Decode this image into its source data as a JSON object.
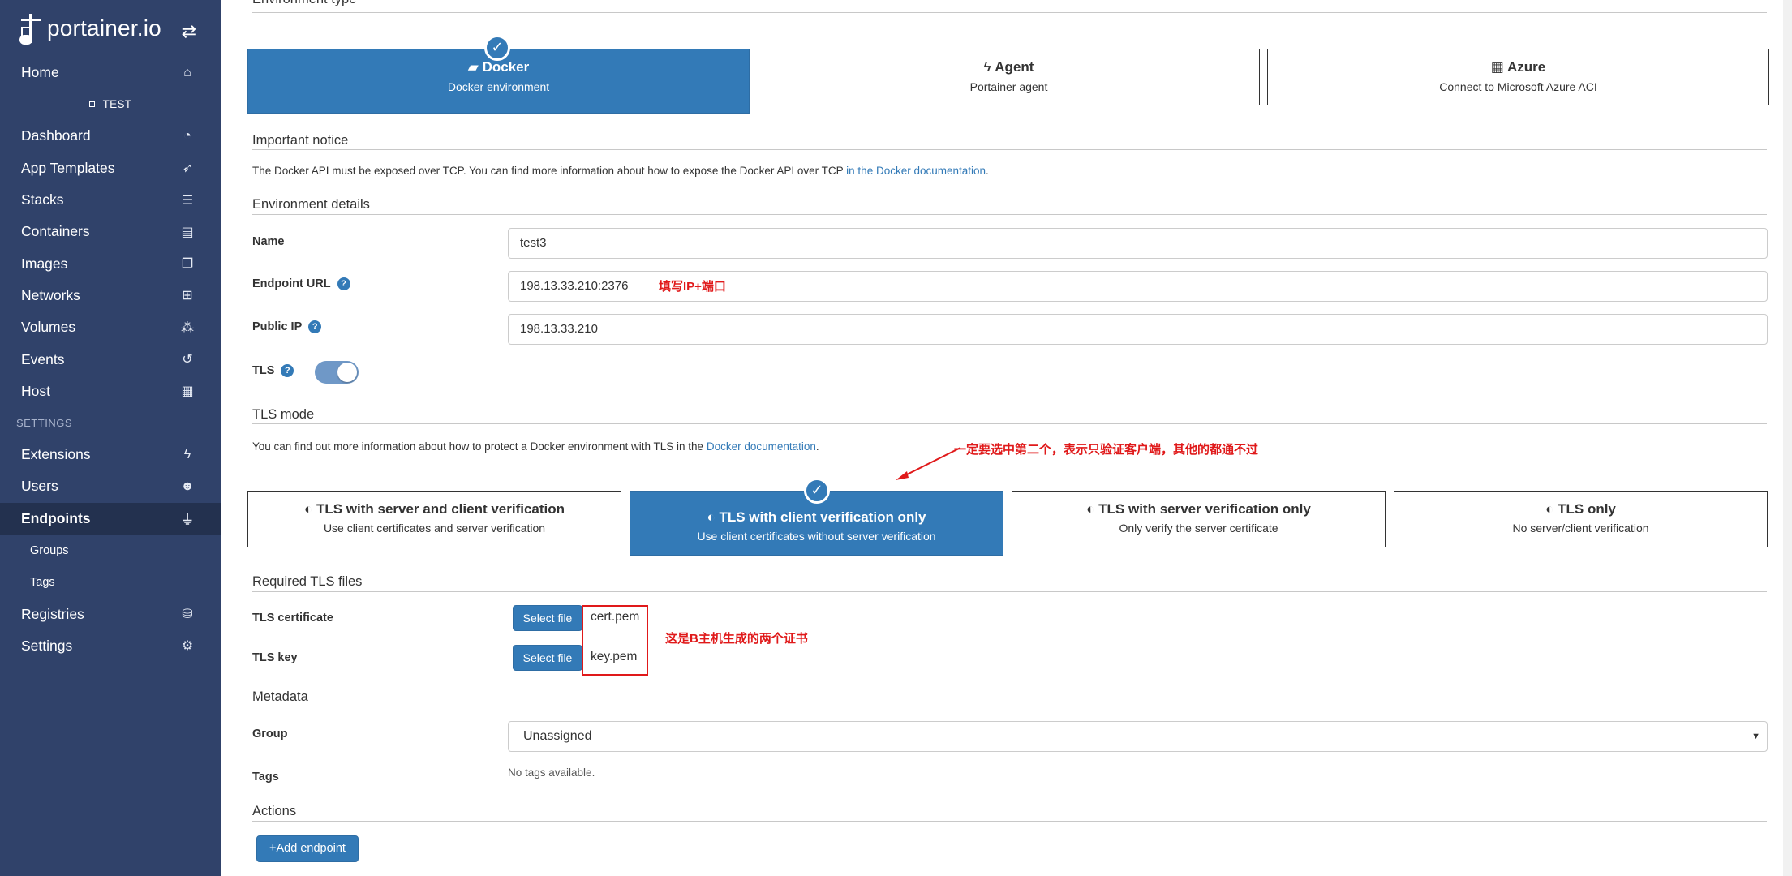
{
  "sidebar": {
    "logo_text": "portainer.io",
    "toggle_icon": "swap-arrows-icon",
    "home_label": "Home",
    "environment_name": "TEST",
    "items": [
      {
        "label": "Dashboard",
        "icon": "tachometer-icon"
      },
      {
        "label": "App Templates",
        "icon": "rocket-icon"
      },
      {
        "label": "Stacks",
        "icon": "th-list-icon"
      },
      {
        "label": "Containers",
        "icon": "server-icon"
      },
      {
        "label": "Images",
        "icon": "clone-icon"
      },
      {
        "label": "Networks",
        "icon": "sitemap-icon"
      },
      {
        "label": "Volumes",
        "icon": "cubes-icon"
      },
      {
        "label": "Events",
        "icon": "history-icon"
      },
      {
        "label": "Host",
        "icon": "th-icon"
      }
    ],
    "settings_section": "SETTINGS",
    "settings_items": {
      "extensions": "Extensions",
      "users": "Users",
      "endpoints": "Endpoints",
      "groups": "Groups",
      "tags": "Tags",
      "registries": "Registries",
      "settings": "Settings"
    }
  },
  "env_type": {
    "section_title": "Environment type",
    "options": [
      {
        "title": "Docker",
        "desc": "Docker environment",
        "icon": "docker-whale-icon",
        "selected": true
      },
      {
        "title": "Agent",
        "desc": "Portainer agent",
        "icon": "bolt-icon",
        "selected": false
      },
      {
        "title": "Azure",
        "desc": "Connect to Microsoft Azure ACI",
        "icon": "windows-icon",
        "selected": false
      }
    ]
  },
  "notice": {
    "title": "Important notice",
    "text": "The Docker API must be exposed over TCP. You can find more information about how to expose the Docker API over TCP ",
    "link": "in the Docker documentation",
    "suffix": "."
  },
  "details": {
    "title": "Environment details",
    "name_label": "Name",
    "name_value": "test3",
    "url_label": "Endpoint URL",
    "url_value": "198.13.33.210:2376",
    "url_annotation": "填写IP+端口",
    "public_ip_label": "Public IP",
    "public_ip_value": "198.13.33.210",
    "tls_label": "TLS",
    "tls_enabled": true
  },
  "tls_mode": {
    "title": "TLS mode",
    "text": "You can find out more information about how to protect a Docker environment with TLS in the ",
    "link": "Docker documentation",
    "suffix": ".",
    "annotation": "一定要选中第二个，表示只验证客户端，其他的都通不过",
    "options": [
      {
        "title": "TLS with server and client verification",
        "desc": "Use client certificates and server verification",
        "selected": false
      },
      {
        "title": "TLS with client verification only",
        "desc": "Use client certificates without server verification",
        "selected": true
      },
      {
        "title": "TLS with server verification only",
        "desc": "Only verify the server certificate",
        "selected": false
      },
      {
        "title": "TLS only",
        "desc": "No server/client verification",
        "selected": false
      }
    ]
  },
  "tls_files": {
    "title": "Required TLS files",
    "cert_label": "TLS certificate",
    "key_label": "TLS key",
    "select_file_label": "Select file",
    "cert_file": "cert.pem",
    "key_file": "key.pem",
    "annotation": "这是B主机生成的两个证书"
  },
  "metadata": {
    "title": "Metadata",
    "group_label": "Group",
    "group_value": "Unassigned",
    "tags_label": "Tags",
    "tags_value": "No tags available."
  },
  "actions": {
    "title": "Actions",
    "add_endpoint_label": "Add endpoint"
  },
  "colors": {
    "sidebar_bg": "#30426a",
    "primary": "#337ab7",
    "annotation_red": "#e0191a"
  }
}
